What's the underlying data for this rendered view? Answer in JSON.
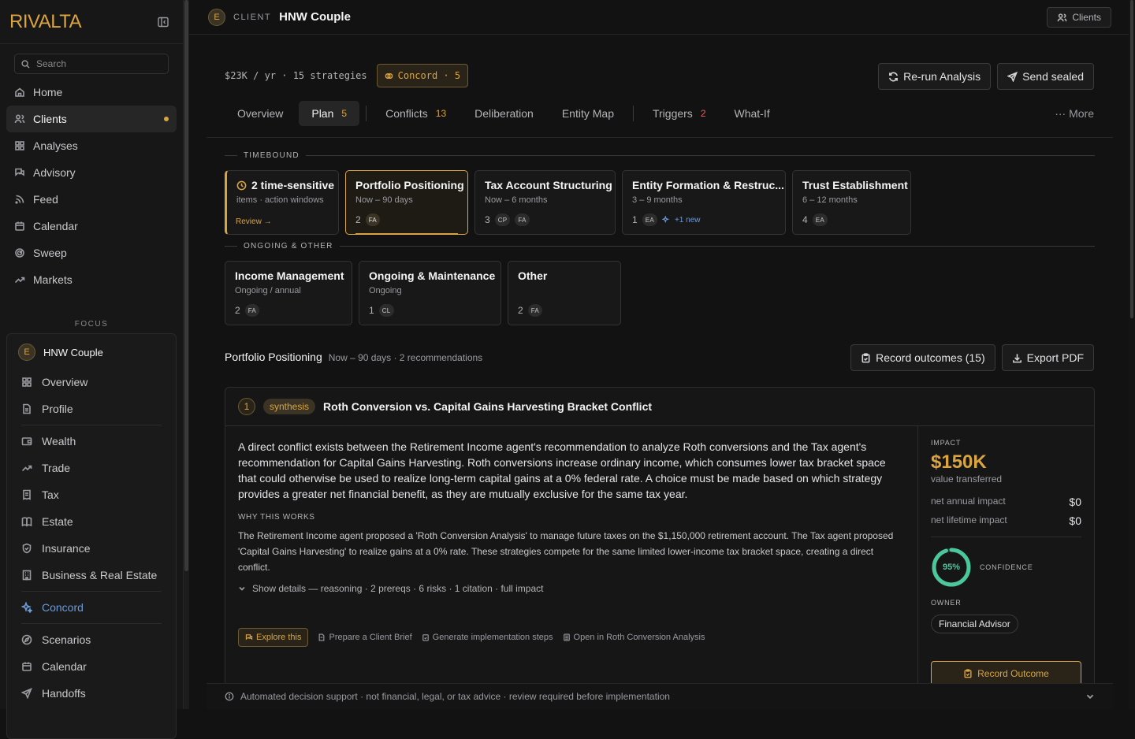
{
  "app": {
    "logo": "RIVALTA"
  },
  "sidebar": {
    "search_placeholder": "Search",
    "nav": [
      {
        "label": "Home",
        "icon": "home-icon"
      },
      {
        "label": "Clients",
        "icon": "users-icon",
        "active": true,
        "indicator": true
      },
      {
        "label": "Analyses",
        "icon": "grid-icon"
      },
      {
        "label": "Advisory",
        "icon": "chat-icon"
      },
      {
        "label": "Feed",
        "icon": "rss-icon"
      },
      {
        "label": "Calendar",
        "icon": "calendar-icon"
      },
      {
        "label": "Sweep",
        "icon": "radar-icon"
      },
      {
        "label": "Markets",
        "icon": "trend-icon"
      }
    ],
    "focus_label": "FOCUS",
    "focus_client": {
      "initial": "E",
      "name": "HNW Couple"
    },
    "focus_items": [
      {
        "label": "Overview"
      },
      {
        "label": "Profile"
      },
      {
        "label": "Wealth"
      },
      {
        "label": "Trade"
      },
      {
        "label": "Tax"
      },
      {
        "label": "Estate"
      },
      {
        "label": "Insurance"
      },
      {
        "label": "Business & Real Estate"
      },
      {
        "label": "Concord"
      },
      {
        "label": "Scenarios"
      },
      {
        "label": "Calendar"
      },
      {
        "label": "Handoffs"
      }
    ]
  },
  "header": {
    "initial": "E",
    "label": "CLIENT",
    "title": "HNW Couple",
    "clients_button": "Clients"
  },
  "summary": {
    "meta": "$23K / yr · 15 strategies",
    "concord_pill": "Concord · 5"
  },
  "actions": {
    "rerun": "Re-run Analysis",
    "send": "Send sealed"
  },
  "tabs": [
    {
      "label": "Overview",
      "count": ""
    },
    {
      "label": "Plan",
      "count": "5",
      "active": true
    },
    {
      "label": "Conflicts",
      "count": "13"
    },
    {
      "label": "Deliberation",
      "count": ""
    },
    {
      "label": "Entity Map",
      "count": ""
    },
    {
      "label": "Triggers",
      "count": "2",
      "red": true
    },
    {
      "label": "What-If",
      "count": ""
    }
  ],
  "more": "··· More",
  "timebound": {
    "label": "TIMEBOUND",
    "urgent": {
      "title": "2 time-sensitive",
      "sub": "items · action windows",
      "link": "Review →"
    },
    "cards": [
      {
        "title": "Portfolio Positioning",
        "sub": "Now – 90 days",
        "count": "2",
        "tags": [
          "FA"
        ],
        "new": "",
        "active": true
      },
      {
        "title": "Tax Account Structuring",
        "sub": "Now – 6 months",
        "count": "3",
        "tags": [
          "CP",
          "FA"
        ],
        "new": ""
      },
      {
        "title": "Entity Formation & Restruc...",
        "sub": "3 – 9 months",
        "count": "1",
        "tags": [
          "EA"
        ],
        "new": "+1 new"
      },
      {
        "title": "Trust Establishment",
        "sub": "6 – 12 months",
        "count": "4",
        "tags": [
          "EA"
        ],
        "new": ""
      }
    ]
  },
  "ongoing": {
    "label": "ONGOING & OTHER",
    "cards": [
      {
        "title": "Income Management",
        "sub": "Ongoing / annual",
        "count": "2",
        "tags": [
          "FA"
        ]
      },
      {
        "title": "Ongoing & Maintenance",
        "sub": "Ongoing",
        "count": "1",
        "tags": [
          "CL"
        ]
      },
      {
        "title": "Other",
        "sub": "",
        "count": "2",
        "tags": [
          "FA"
        ]
      }
    ]
  },
  "selected": {
    "title": "Portfolio Positioning",
    "sub": "Now – 90 days · 2 recommendations",
    "record_btn": "Record outcomes (15)",
    "export_btn": "Export PDF"
  },
  "recommendation": {
    "number": "1",
    "badge": "synthesis",
    "title": "Roth Conversion vs. Capital Gains Harvesting Bracket Conflict",
    "body": "A direct conflict exists between the Retirement Income agent's recommendation to analyze Roth conversions and the Tax agent's recommendation for Capital Gains Harvesting. Roth conversions increase ordinary income, which consumes lower tax bracket space that could otherwise be used to realize long-term capital gains at a 0% federal rate. A choice must be made based on which strategy provides a greater net financial benefit, as they are mutually exclusive for the same tax year.",
    "why_label": "WHY THIS WORKS",
    "why_text": "The Retirement Income agent proposed a 'Roth Conversion Analysis' to manage future taxes on the $1,150,000 retirement account. The Tax agent proposed 'Capital Gains Harvesting' to realize gains at a 0% rate. These strategies compete for the same limited lower-income tax bracket space, creating a direct conflict.",
    "details": "Show details — reasoning · 2 prereqs · 6 risks · 1 citation · full impact",
    "actions": {
      "explore": "Explore this",
      "brief": "Prepare a Client Brief",
      "steps": "Generate implementation steps",
      "open": "Open in Roth Conversion Analysis"
    },
    "impact": {
      "label": "IMPACT",
      "value": "$150K",
      "sub": "value transferred",
      "annual_label": "net annual impact",
      "annual_value": "$0",
      "lifetime_label": "net lifetime impact",
      "lifetime_value": "$0",
      "confidence": 0.95,
      "confidence_text": "95%",
      "confidence_label": "CONFIDENCE",
      "owner_label": "OWNER",
      "owner": "Financial Advisor",
      "record_btn": "Record Outcome"
    }
  },
  "footer": {
    "text": "Automated decision support · not financial, legal, or tax advice · review required before implementation"
  },
  "colors": {
    "accent": "#d9a441",
    "confidence": "#4cc79c",
    "concord": "#6c9bd9",
    "alert": "#e06464"
  }
}
